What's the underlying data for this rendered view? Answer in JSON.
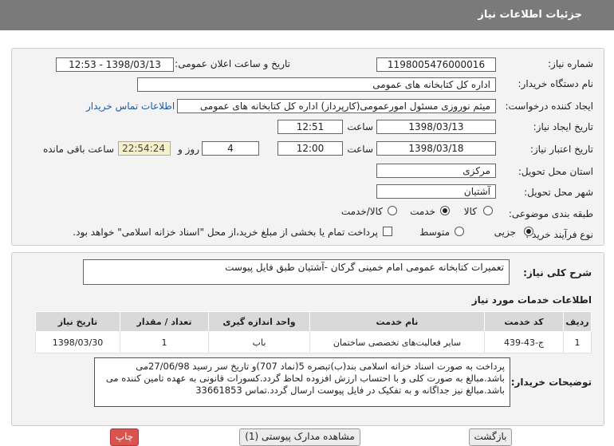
{
  "header": {
    "title": "جزئیات اطلاعات نیاز"
  },
  "form": {
    "need_number_label": "شماره نیاز:",
    "need_number": "1198005476000016",
    "announce_label": "تاریخ و ساعت اعلان عمومی:",
    "announce_value": "1398/03/13 - 12:53",
    "buyer_label": "نام دستگاه خریدار:",
    "buyer_value": "اداره کل کتابخانه های عمومی",
    "requester_label": "ایجاد کننده درخواست:",
    "requester_value": "میثم نوروزی مسئول امورعمومی(کارپرداز) اداره کل کتابخانه های عمومی",
    "contact_link": "اطلاعات تماس خریدار",
    "created_label": "تاریخ ایجاد نیاز:",
    "created_date": "1398/03/13",
    "time_label": "ساعت",
    "created_time": "12:51",
    "validity_label": "تاریخ اعتبار نیاز:",
    "validity_date": "1398/03/18",
    "validity_time": "12:00",
    "days_value": "4",
    "days_label": "روز و",
    "remaining_time": "22:54:24",
    "remaining_label": "ساعت باقی مانده",
    "province_label": "استان محل تحویل:",
    "province_value": "مرکزی",
    "city_label": "شهر محل تحویل:",
    "city_value": "آشتیان",
    "category_label": "طبقه بندی موضوعی:",
    "category_options": [
      "کالا",
      "خدمت",
      "کالا/خدمت"
    ],
    "category_selected": "خدمت",
    "process_label": "نوع فرآیند خرید :",
    "process_options": [
      "جزیی",
      "متوسط"
    ],
    "process_selected": "جزیی",
    "payment_note": "پرداخت تمام یا بخشی از مبلغ خرید،از محل \"اسناد خزانه اسلامی\" خواهد بود."
  },
  "summary": {
    "label": "شرح کلی نیاز:",
    "value": "تعمیرات کتابخانه عمومی امام خمینی گرکان -آشتیان طبق فایل پیوست"
  },
  "services": {
    "title": "اطلاعات خدمات مورد نیاز",
    "columns": [
      "ردیف",
      "کد خدمت",
      "نام خدمت",
      "واحد اندازه گیری",
      "تعداد / مقدار",
      "تاریخ نیاز"
    ],
    "rows": [
      [
        "1",
        "ج-43-439",
        "سایر فعالیت‌های تخصصی ساختمان",
        "باب",
        "1",
        "1398/03/30"
      ]
    ]
  },
  "buyer_notes": {
    "label": "توضیحات خریدار:",
    "text": "پرداخت به صورت اسناد خزانه اسلامی بند(ب)تبصره 5(نماد 707)و تاریخ سر رسید 27/06/98می باشد.مبالغ به صورت کلی و با احتساب ارزش افزوده لحاظ گردد.کسورات قانونی به عهده تامین کننده می باشد.مبالغ نیز جداگانه و به تفکیک در فایل پیوست ارسال گردد.تماس 33661853"
  },
  "footer_buttons": [
    "بازگشت",
    "مشاهده مدارک پیوستی (1)",
    "چاپ"
  ],
  "colors": {
    "header_bg": "#7a7a7a",
    "panel_bg": "#f3f3f3",
    "link": "#1e5aa8"
  }
}
